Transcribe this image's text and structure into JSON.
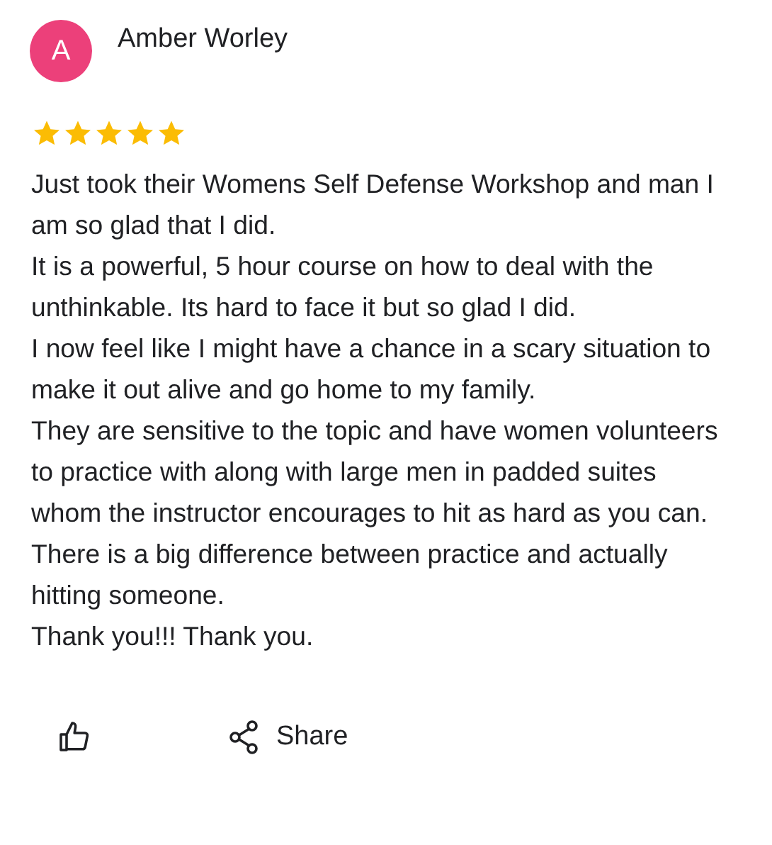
{
  "review": {
    "avatar_letter": "A",
    "author": "Amber Worley",
    "stars": 5,
    "paragraphs": [
      "Just took their Womens Self Defense Workshop and man I am so glad that I did.",
      "It is a powerful, 5 hour course on how to deal with the unthinkable. Its hard to face it but so glad I did.",
      "I now feel like I might have a chance in a scary situation to make it out alive and go home to my family.",
      "They are sensitive to the topic and have women volunteers to practice with along with large men in padded suites whom the instructor encourages to hit as hard as you can.",
      "There is a big difference between practice and actually hitting someone.",
      "Thank you!!! Thank you."
    ]
  },
  "actions": {
    "share_label": "Share"
  }
}
